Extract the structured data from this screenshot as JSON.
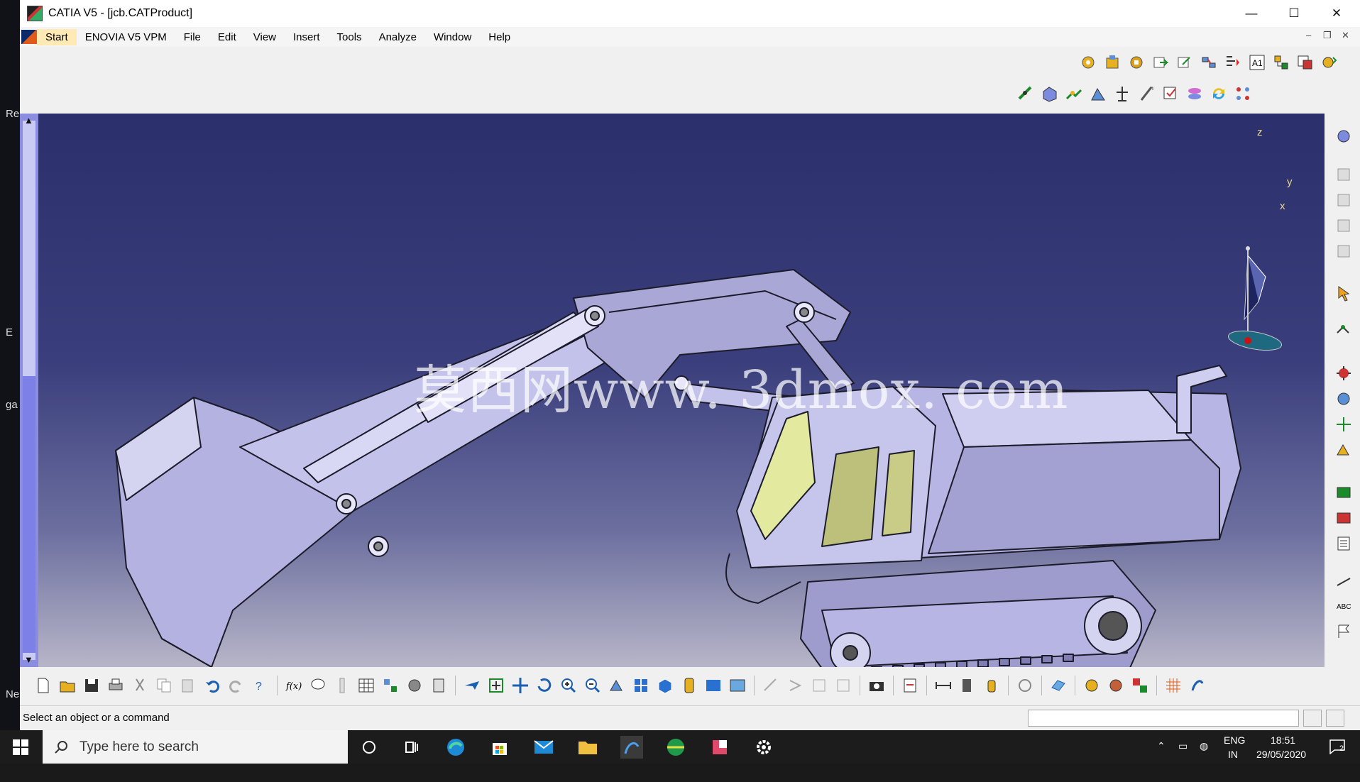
{
  "desktop_edge": {
    "labels": [
      "Re",
      "E",
      "ga",
      "Ne"
    ]
  },
  "window": {
    "title": "CATIA V5 - [jcb.CATProduct]",
    "minimize": "—",
    "maximize": "☐",
    "close": "✕"
  },
  "menu": {
    "items": [
      "Start",
      "ENOVIA V5 VPM",
      "File",
      "Edit",
      "View",
      "Insert",
      "Tools",
      "Analyze",
      "Window",
      "Help"
    ],
    "doc_minimize": "–",
    "doc_restore": "❐",
    "doc_close": "✕"
  },
  "viewport": {
    "watermark": "莫西网www. 3dmox. com",
    "compass_axes": {
      "z": "z",
      "y": "y",
      "x": "x"
    },
    "mini_axes": {
      "z": "z",
      "y": "y",
      "x": "x"
    },
    "scroll_up": "▲",
    "scroll_down": "▼"
  },
  "status": {
    "message": "Select an object or a command",
    "command_input": ""
  },
  "taskbar": {
    "search_placeholder": "Type here to search",
    "language": "ENG",
    "region": "IN",
    "time": "18:51",
    "date": "29/05/2020",
    "notification_count": "2"
  },
  "colors": {
    "viewport_top": "#2b2f6b",
    "viewport_bottom": "#b7b5c8",
    "menu_start_bg": "#ffeab5",
    "model_fill": "#b9b8e6",
    "window_glass": "#e3eaa0"
  }
}
